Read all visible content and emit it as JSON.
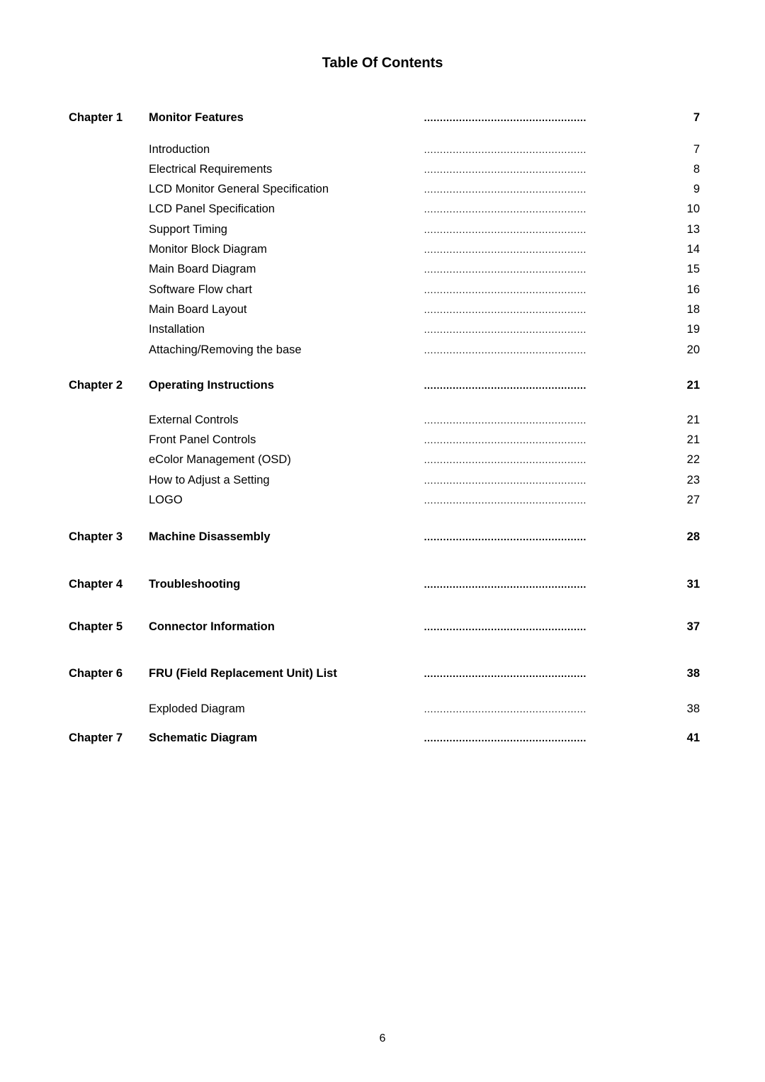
{
  "title": "Table Of Contents",
  "entries": [
    {
      "type": "chapter",
      "chapter": "Chapter 1",
      "label": "Monitor Features",
      "page": "7"
    },
    {
      "type": "section",
      "label": "Introduction",
      "page": "7"
    },
    {
      "type": "section",
      "label": "Electrical Requirements",
      "page": "8"
    },
    {
      "type": "section",
      "label": "LCD Monitor General Specification",
      "page": "9"
    },
    {
      "type": "section",
      "label": "LCD Panel Specification",
      "page": "10"
    },
    {
      "type": "section",
      "label": "Support Timing",
      "page": "13"
    },
    {
      "type": "section",
      "label": "Monitor Block Diagram",
      "page": "14"
    },
    {
      "type": "section",
      "label": "Main Board Diagram",
      "page": "15"
    },
    {
      "type": "section",
      "label": "Software Flow chart",
      "page": "16"
    },
    {
      "type": "section",
      "label": "Main Board Layout",
      "page": "18"
    },
    {
      "type": "section",
      "label": "Installation",
      "page": "19"
    },
    {
      "type": "section",
      "label": "Attaching/Removing the base",
      "page": "20"
    },
    {
      "type": "chapter",
      "chapter": "Chapter 2",
      "label": "Operating Instructions",
      "page": "21"
    },
    {
      "type": "section",
      "label": "External Controls",
      "page": "21"
    },
    {
      "type": "section",
      "label": "Front Panel Controls",
      "page": "21"
    },
    {
      "type": "section",
      "label": "eColor Management (OSD)",
      "page": "22"
    },
    {
      "type": "section",
      "label": "How to Adjust a Setting",
      "page": "23"
    },
    {
      "type": "section",
      "label": "LOGO",
      "page": "27"
    },
    {
      "type": "chapter",
      "chapter": "Chapter 3",
      "label": "Machine Disassembly",
      "page": "28"
    },
    {
      "type": "chapter",
      "chapter": "Chapter 4",
      "label": "Troubleshooting",
      "page": "31"
    },
    {
      "type": "chapter",
      "chapter": "Chapter 5",
      "label": "Connector Information",
      "page": "37"
    },
    {
      "type": "chapter",
      "chapter": "Chapter 6",
      "label": "FRU (Field Replacement Unit) List",
      "page": "38"
    },
    {
      "type": "section",
      "label": "Exploded Diagram",
      "page": "38"
    },
    {
      "type": "chapter",
      "chapter": "Chapter 7",
      "label": "Schematic Diagram",
      "page": "41"
    }
  ],
  "leader": "……………………………………………",
  "footer": {
    "page_number": "6"
  }
}
